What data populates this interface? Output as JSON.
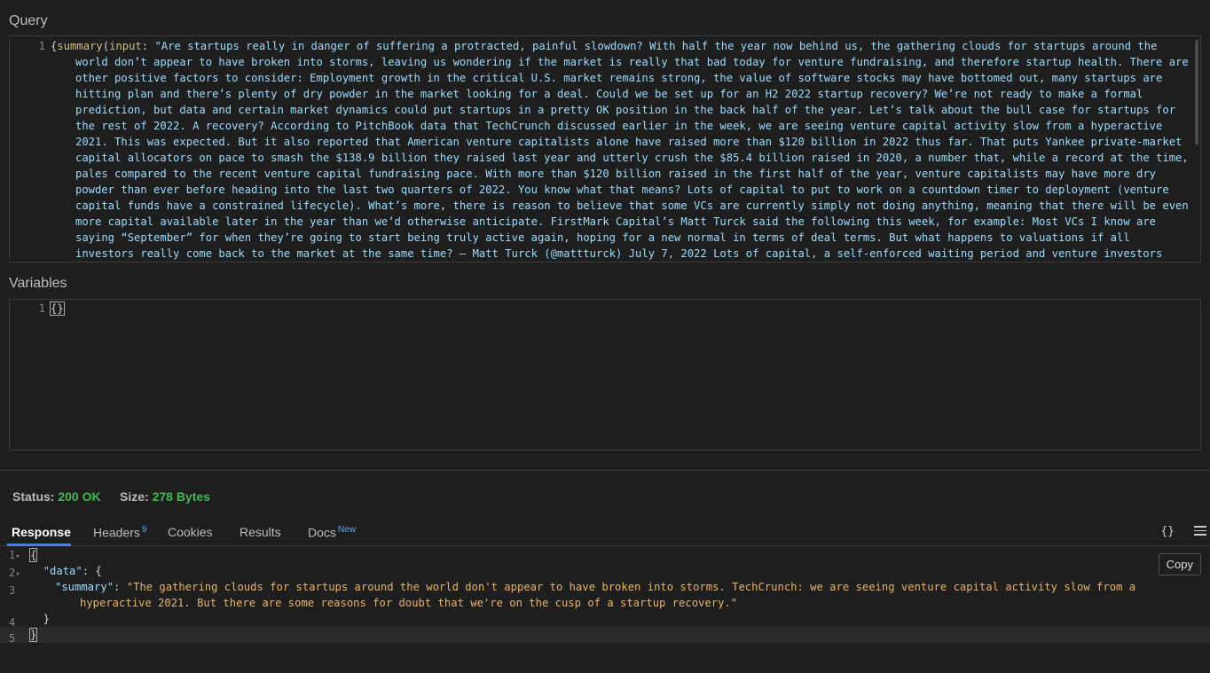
{
  "query": {
    "label": "Query",
    "line_number": "1",
    "open_brace": "{",
    "fn_name": "summary",
    "paren_open": "(",
    "arg_name": "input",
    "colon": ": ",
    "text": "\"Are startups really in danger of suffering a protracted, painful slowdown? With half the year now behind us, the gathering clouds for startups around the world don’t appear to have broken into storms, leaving us wondering if the market is really that bad today for venture fundraising, and therefore startup health. There are other positive factors to consider: Employment growth in the critical U.S. market remains strong, the value of software stocks may have bottomed out, many startups are hitting plan and there’s plenty of dry powder in the market looking for a deal. Could we be set up for an H2 2022 startup recovery? We’re not ready to make a formal prediction, but data and certain market dynamics could put startups in a pretty OK position in the back half of the year. Let’s talk about the bull case for startups for the rest of 2022. A recovery? According to PitchBook data that TechCrunch discussed earlier in the week, we are seeing venture capital activity slow from a hyperactive 2021. This was expected. But it also reported that American venture capitalists alone have raised more than $120 billion in 2022 thus far. That puts Yankee private-market capital allocators on pace to smash the $138.9 billion they raised last year and utterly crush the $85.4 billion raised in 2020, a number that, while a record at the time, pales compared to the recent venture capital fundraising pace. With more than $120 billion raised in the first half of the year, venture capitalists may have more dry powder than ever before heading into the last two quarters of 2022. You know what that means? Lots of capital to put to work on a countdown timer to deployment (venture capital funds have a constrained lifecycle). What’s more, there is reason to believe that some VCs are currently simply not doing anything, meaning that there will be even more capital available later in the year than we’d otherwise anticipate. FirstMark Capital’s Matt Turck said the following this week, for example: Most VCs I know are saying “September” for when they’re going to start being truly active again, hoping for a new normal in terms of deal terms. But what happens to valuations if all investors really come back to the market at the same time? — Matt Turck (@mattturck) July 7, 2022 Lots of capital, a self-enforced waiting period and venture investors coming back to the market at the same time, en masse?"
  },
  "variables": {
    "label": "Variables",
    "line_number": "1",
    "content": "{}"
  },
  "status": {
    "status_label": "Status:",
    "status_value": "200 OK",
    "size_label": "Size:",
    "size_value": "278 Bytes"
  },
  "tabs": [
    {
      "label": "Response",
      "active": true
    },
    {
      "label": "Headers",
      "badge": "9"
    },
    {
      "label": "Cookies"
    },
    {
      "label": "Results"
    },
    {
      "label": "Docs",
      "badge": "New"
    }
  ],
  "toolbar": {
    "format_icon_text": "{}",
    "copy_label": "Copy"
  },
  "response": {
    "line_numbers": [
      "1",
      "2",
      "3",
      "",
      "4",
      "5"
    ],
    "fold_marker": "▾",
    "l1": "{",
    "l2_key": "\"data\"",
    "l2_rest": ": {",
    "l3_key": "\"summary\"",
    "l3_colon": ": ",
    "l3_value": "\"The gathering clouds for startups around the world don't appear to have broken into storms. TechCrunch: we are seeing venture capital activity slow from a hyperactive 2021. But there are some reasons for doubt that we're on the cusp of a startup recovery.\"",
    "l4": "}",
    "l5": "}"
  },
  "colors": {
    "background": "#1e1e1e",
    "status_ok": "#3fb950",
    "tab_accent": "#3b82f6",
    "string_value": "#e8b36a",
    "json_key": "#9cdcfe"
  }
}
